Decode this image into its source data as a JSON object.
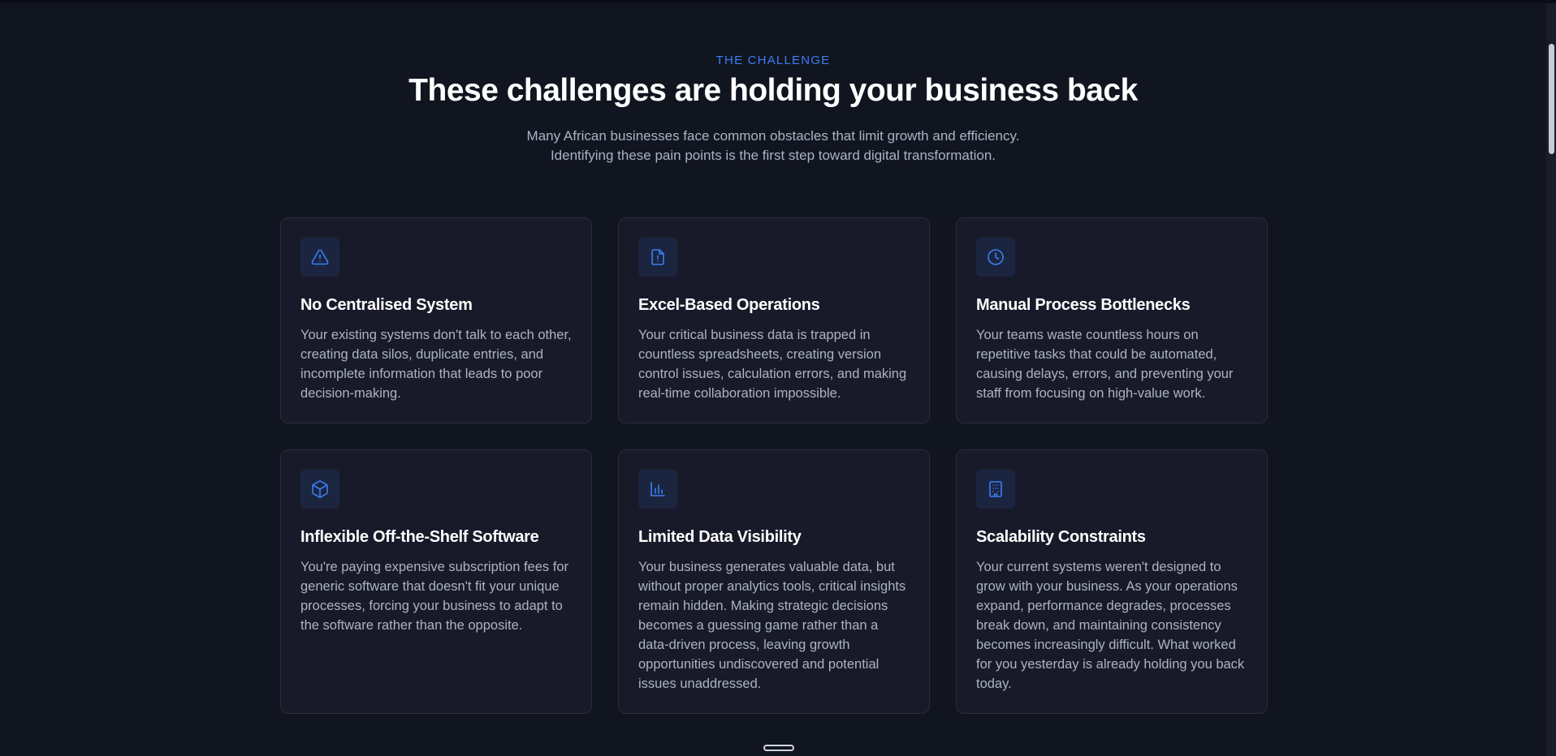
{
  "section": {
    "eyebrow": "THE CHALLENGE",
    "title": "These challenges are holding your business back",
    "subtitle_line1": "Many African businesses face common obstacles that limit growth and efficiency.",
    "subtitle_line2": "Identifying these pain points is the first step toward digital transformation."
  },
  "cards": [
    {
      "icon": "warning-triangle-icon",
      "title": "No Centralised System",
      "description": "Your existing systems don't talk to each other, creating data silos, duplicate entries, and incomplete information that leads to poor decision-making."
    },
    {
      "icon": "document-alert-icon",
      "title": "Excel-Based Operations",
      "description": "Your critical business data is trapped in countless spreadsheets, creating version control issues, calculation errors, and making real-time collaboration impossible."
    },
    {
      "icon": "clock-icon",
      "title": "Manual Process Bottlenecks",
      "description": "Your teams waste countless hours on repetitive tasks that could be automated, causing delays, errors, and preventing your staff from focusing on high-value work."
    },
    {
      "icon": "box-icon",
      "title": "Inflexible Off-the-Shelf Software",
      "description": "You're paying expensive subscription fees for generic software that doesn't fit your unique processes, forcing your business to adapt to the software rather than the opposite."
    },
    {
      "icon": "bar-chart-icon",
      "title": "Limited Data Visibility",
      "description": "Your business generates valuable data, but without proper analytics tools, critical insights remain hidden. Making strategic decisions becomes a guessing game rather than a data-driven process, leaving growth opportunities undiscovered and potential issues unaddressed."
    },
    {
      "icon": "building-icon",
      "title": "Scalability Constraints",
      "description": "Your current systems weren't designed to grow with your business. As your operations expand, performance degrades, processes break down, and maintaining consistency becomes increasingly difficult. What worked for you yesterday is already holding you back today."
    }
  ],
  "colors": {
    "background": "#111520",
    "card": "#191a29",
    "accent": "#3b7ef6",
    "text_muted": "#aab3c5"
  }
}
